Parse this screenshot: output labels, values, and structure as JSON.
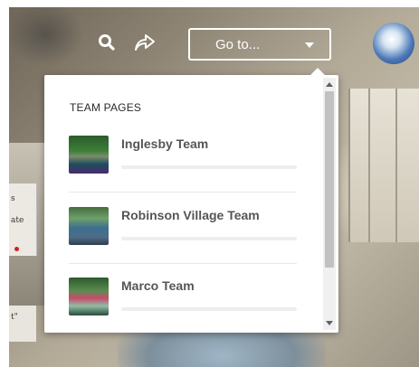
{
  "toolbar": {
    "search_icon": "search-icon",
    "share_icon": "share-icon",
    "goto_label": "Go to...",
    "caret_icon": "caret-down-icon"
  },
  "dropdown": {
    "section_title": "TEAM PAGES",
    "items": [
      {
        "label": "Inglesby Team"
      },
      {
        "label": "Robinson Village Team"
      },
      {
        "label": "Marco Team"
      }
    ]
  },
  "background_text": {
    "line1": "s",
    "line2": "ate",
    "line3": "t\""
  },
  "colors": {
    "dropdown_bg": "#ffffff",
    "item_text": "#555555",
    "title_text": "#2b2b2b"
  }
}
